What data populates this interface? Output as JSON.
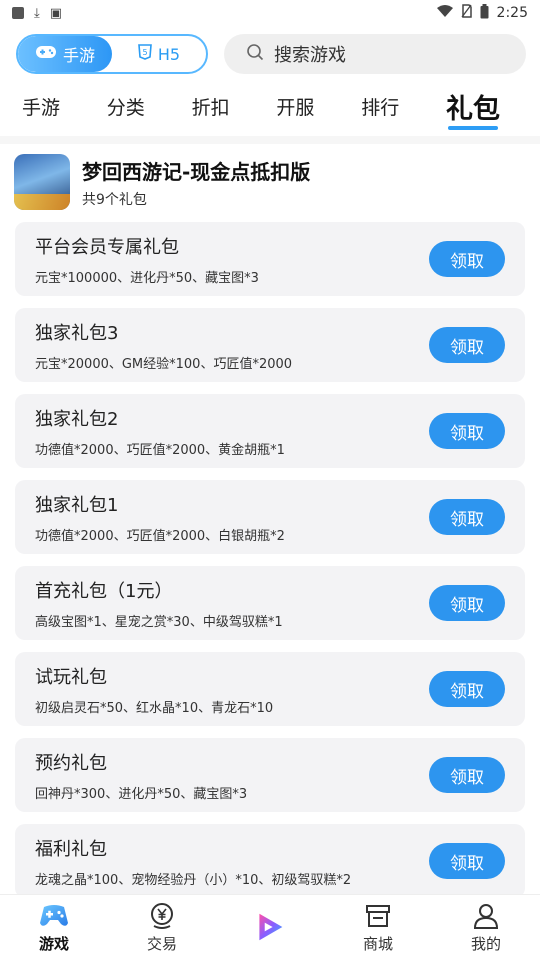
{
  "status_bar": {
    "time": "2:25",
    "left_icons": [
      "app-square-icon",
      "download-icon",
      "screenshot-icon"
    ],
    "right_icons": [
      "wifi-icon",
      "no-sim-icon",
      "battery-icon"
    ]
  },
  "mode_switch": {
    "options": [
      {
        "label": "手游",
        "icon": "gamepad-icon",
        "active": true
      },
      {
        "label": "H5",
        "icon": "html5-icon",
        "active": false
      }
    ]
  },
  "search": {
    "placeholder": "搜索游戏",
    "icon": "search-icon"
  },
  "tabs": [
    {
      "label": "手游",
      "active": false
    },
    {
      "label": "分类",
      "active": false
    },
    {
      "label": "折扣",
      "active": false
    },
    {
      "label": "开服",
      "active": false
    },
    {
      "label": "排行",
      "active": false
    },
    {
      "label": "礼包",
      "active": true
    }
  ],
  "game": {
    "title": "梦回西游记-现金点抵扣版",
    "gift_count": "共9个礼包"
  },
  "gifts": [
    {
      "name": "平台会员专属礼包",
      "desc": "元宝*100000、进化丹*50、藏宝图*3",
      "button": "领取"
    },
    {
      "name": "独家礼包3",
      "desc": "元宝*20000、GM经验*100、巧匠值*2000",
      "button": "领取"
    },
    {
      "name": "独家礼包2",
      "desc": "功德值*2000、巧匠值*2000、黄金胡瓶*1",
      "button": "领取"
    },
    {
      "name": "独家礼包1",
      "desc": "功德值*2000、巧匠值*2000、白银胡瓶*2",
      "button": "领取"
    },
    {
      "name": "首充礼包（1元）",
      "desc": "高级宝图*1、星宠之赏*30、中级驾驭糕*1",
      "button": "领取"
    },
    {
      "name": "试玩礼包",
      "desc": "初级启灵石*50、红水晶*10、青龙石*10",
      "button": "领取"
    },
    {
      "name": "预约礼包",
      "desc": "回神丹*300、进化丹*50、藏宝图*3",
      "button": "领取"
    },
    {
      "name": "福利礼包",
      "desc": "龙魂之晶*100、宠物经验丹（小）*10、初级驾驭糕*2",
      "button": "领取"
    }
  ],
  "bottom_nav": [
    {
      "label": "游戏",
      "icon": "gamepad-icon",
      "active": true
    },
    {
      "label": "交易",
      "icon": "yen-coin-icon",
      "active": false
    },
    {
      "label": "",
      "icon": "play-icon",
      "active": false
    },
    {
      "label": "商城",
      "icon": "store-icon",
      "active": false
    },
    {
      "label": "我的",
      "icon": "user-icon",
      "active": false
    }
  ],
  "colors": {
    "accent": "#2d95ef",
    "card_bg": "#f3f3f5"
  }
}
